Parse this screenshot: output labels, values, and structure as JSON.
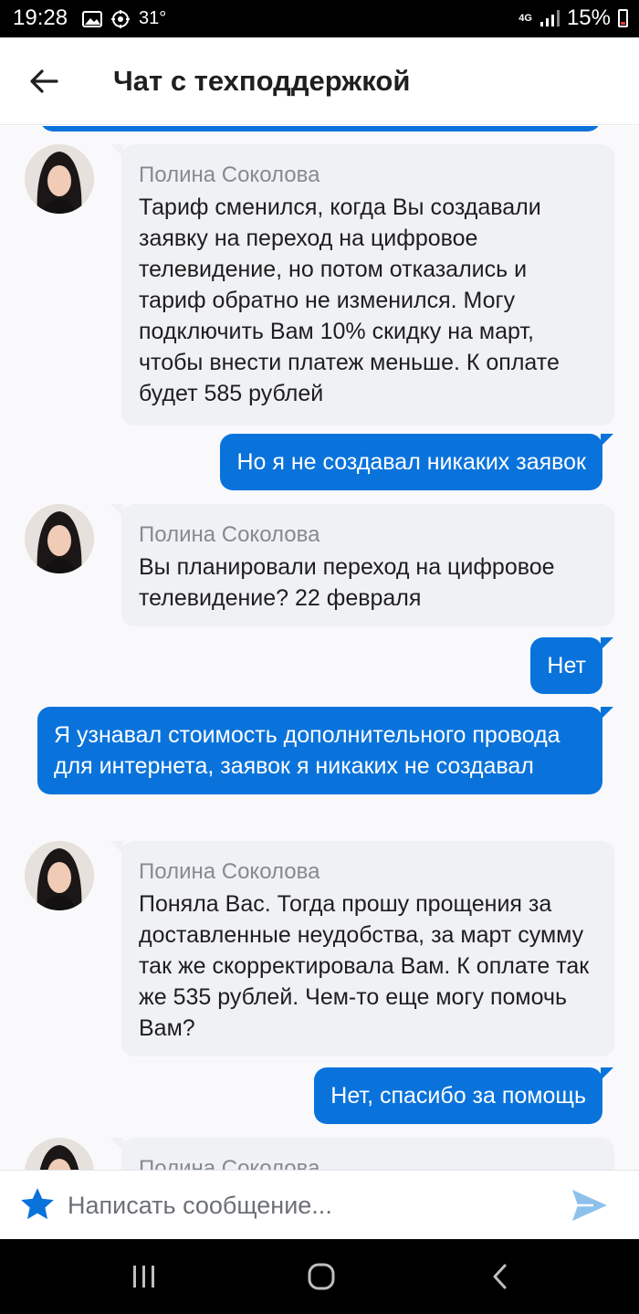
{
  "status_bar": {
    "time": "19:28",
    "temperature": "31°",
    "network": "4G",
    "battery": "15%"
  },
  "header": {
    "title": "Чат с техподдержкой"
  },
  "messages": [
    {
      "type": "incoming",
      "sender": "Полина Соколова",
      "text": "Тариф сменился, когда Вы создавали заявку на переход на цифровое телевидение, но потом отказались и тариф обратно не изменился. Могу подключить Вам 10% скидку на март, чтобы внести платеж меньше. К оплате будет 585 рублей"
    },
    {
      "type": "outgoing",
      "text": "Но я не создавал никаких заявок"
    },
    {
      "type": "incoming",
      "sender": "Полина Соколова",
      "text": "Вы планировали переход на цифровое телевидение? 22 февраля"
    },
    {
      "type": "outgoing",
      "text": "Нет"
    },
    {
      "type": "outgoing",
      "text": "Я узнавал стоимость дополнительного провода для интернета, заявок я никаких не создавал"
    },
    {
      "type": "incoming",
      "sender": "Полина Соколова",
      "text": "Поняла Вас. Тогда прошу прощения за доставленные неудобства, за март сумму так же скорректировала Вам. К оплате так же 535 рублей. Чем-то еще могу помочь Вам?"
    },
    {
      "type": "outgoing",
      "text": "Нет, спасибо за помощь"
    },
    {
      "type": "incoming",
      "sender": "Полина Соколова",
      "text": ""
    }
  ],
  "composer": {
    "placeholder": "Написать сообщение..."
  },
  "colors": {
    "outgoing_bubble": "#0a73db",
    "incoming_bubble": "#f0f1f4",
    "sender_name": "#858a93"
  },
  "icons": {
    "back": "arrow-left-icon",
    "favorite": "star-icon",
    "send": "send-icon",
    "nav_recent": "recent-apps-icon",
    "nav_home": "home-icon",
    "nav_back": "chevron-left-icon"
  }
}
